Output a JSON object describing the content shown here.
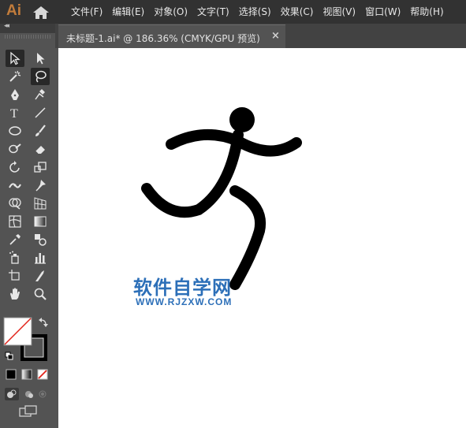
{
  "app": {
    "logo": "Ai"
  },
  "menu": {
    "items": [
      "文件(F)",
      "编辑(E)",
      "对象(O)",
      "文字(T)",
      "选择(S)",
      "效果(C)",
      "视图(V)",
      "窗口(W)",
      "帮助(H)"
    ]
  },
  "document": {
    "tab_title": "未标题-1.ai* @ 186.36% (CMYK/GPU 预览)",
    "close": "×"
  },
  "toolbar": {
    "collapse": "◂◂",
    "tools": [
      "selection-tool",
      "direct-selection-tool",
      "magic-wand-tool",
      "lasso-tool",
      "pen-tool",
      "curvature-tool",
      "type-tool",
      "line-segment-tool",
      "ellipse-tool",
      "paintbrush-tool",
      "shaper-tool",
      "eraser-tool",
      "rotate-tool",
      "scale-tool",
      "width-tool",
      "puppet-warp-tool",
      "shape-builder-tool",
      "perspective-grid-tool",
      "mesh-tool",
      "gradient-tool",
      "eyedropper-tool",
      "blend-tool",
      "symbol-sprayer-tool",
      "column-graph-tool",
      "artboard-tool",
      "slice-tool",
      "hand-tool",
      "zoom-tool"
    ]
  },
  "colors": {
    "fill": "#ffffff",
    "stroke": "#000000",
    "none_slash": "#e2231a",
    "logo": "#c27c3b",
    "watermark": "#2c6fb8"
  },
  "watermark": {
    "main": "软件自学网",
    "sub": "WWW.RJZXW.COM"
  }
}
